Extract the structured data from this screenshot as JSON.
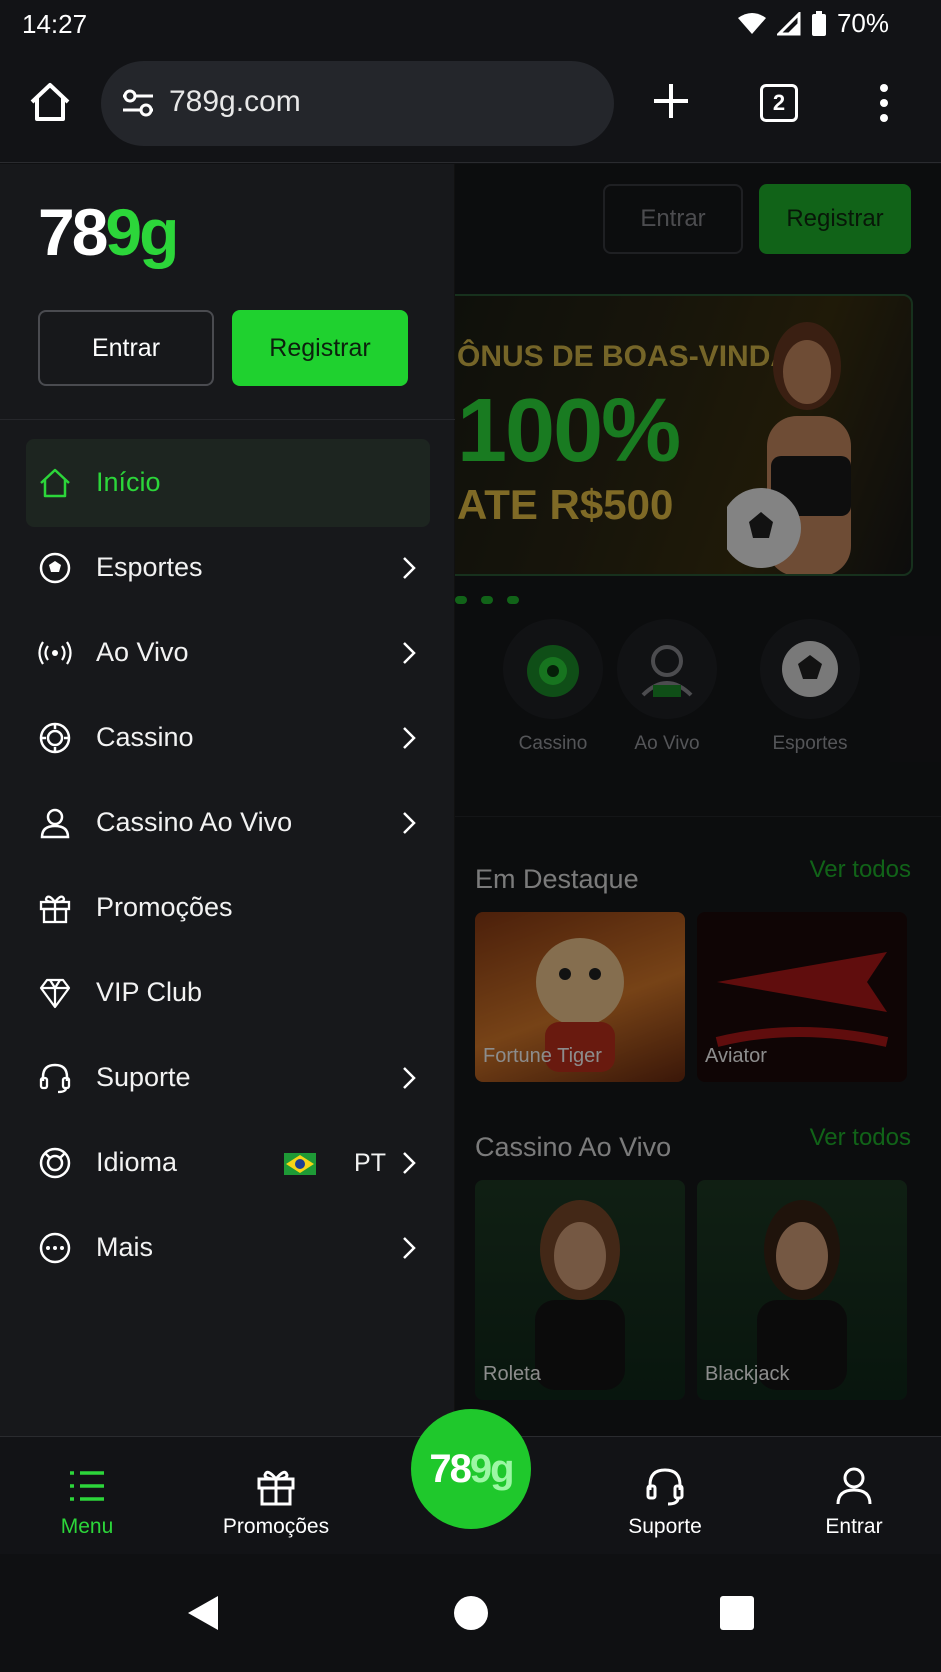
{
  "status_bar": {
    "time": "14:27",
    "battery": "70%"
  },
  "browser": {
    "url": "789g.com",
    "tab_count": "2"
  },
  "drawer": {
    "logo": {
      "white": "78",
      "green": "9g"
    },
    "entrar_label": "Entrar",
    "registrar_label": "Registrar",
    "items": [
      {
        "label": "Início",
        "icon": "home-icon",
        "active": true
      },
      {
        "label": "Esportes",
        "icon": "soccer-ball-icon"
      },
      {
        "label": "Ao Vivo",
        "icon": "broadcast-icon"
      },
      {
        "label": "Cassino",
        "icon": "casino-chip-icon"
      },
      {
        "label": "Cassino Ao Vivo",
        "icon": "person-icon"
      },
      {
        "label": "Promoções",
        "icon": "gift-icon"
      },
      {
        "label": "VIP Club",
        "icon": "diamond-icon"
      },
      {
        "label": "Suporte",
        "icon": "headset-icon"
      },
      {
        "label": "Idioma",
        "icon": "language-icon",
        "value": "PT"
      },
      {
        "label": "Mais",
        "icon": "more-icon"
      }
    ]
  },
  "background_page": {
    "entrar_label": "Entrar",
    "registrar_label": "Registrar",
    "banner": {
      "line1": "ÔNUS DE BOAS-VINDAS",
      "line2": "100%",
      "line3": "ATE R$500"
    },
    "categories": [
      "Cassino",
      "Ao Vivo",
      "Esportes"
    ],
    "featured": {
      "title": "Em Destaque",
      "see_all": "Ver todos",
      "cards": [
        "Fortune Tiger",
        "Aviator"
      ]
    },
    "live_casino": {
      "title": "Cassino Ao Vivo",
      "see_all": "Ver todos",
      "cards": [
        "Roleta",
        "Blackjack"
      ]
    }
  },
  "bottom_nav": {
    "menu": "Menu",
    "promocoes": "Promoções",
    "center_logo": {
      "white": "78",
      "green": "9g"
    },
    "suporte": "Suporte",
    "entrar": "Entrar"
  },
  "colors": {
    "accent": "#1fd12f",
    "background": "#17181b"
  }
}
